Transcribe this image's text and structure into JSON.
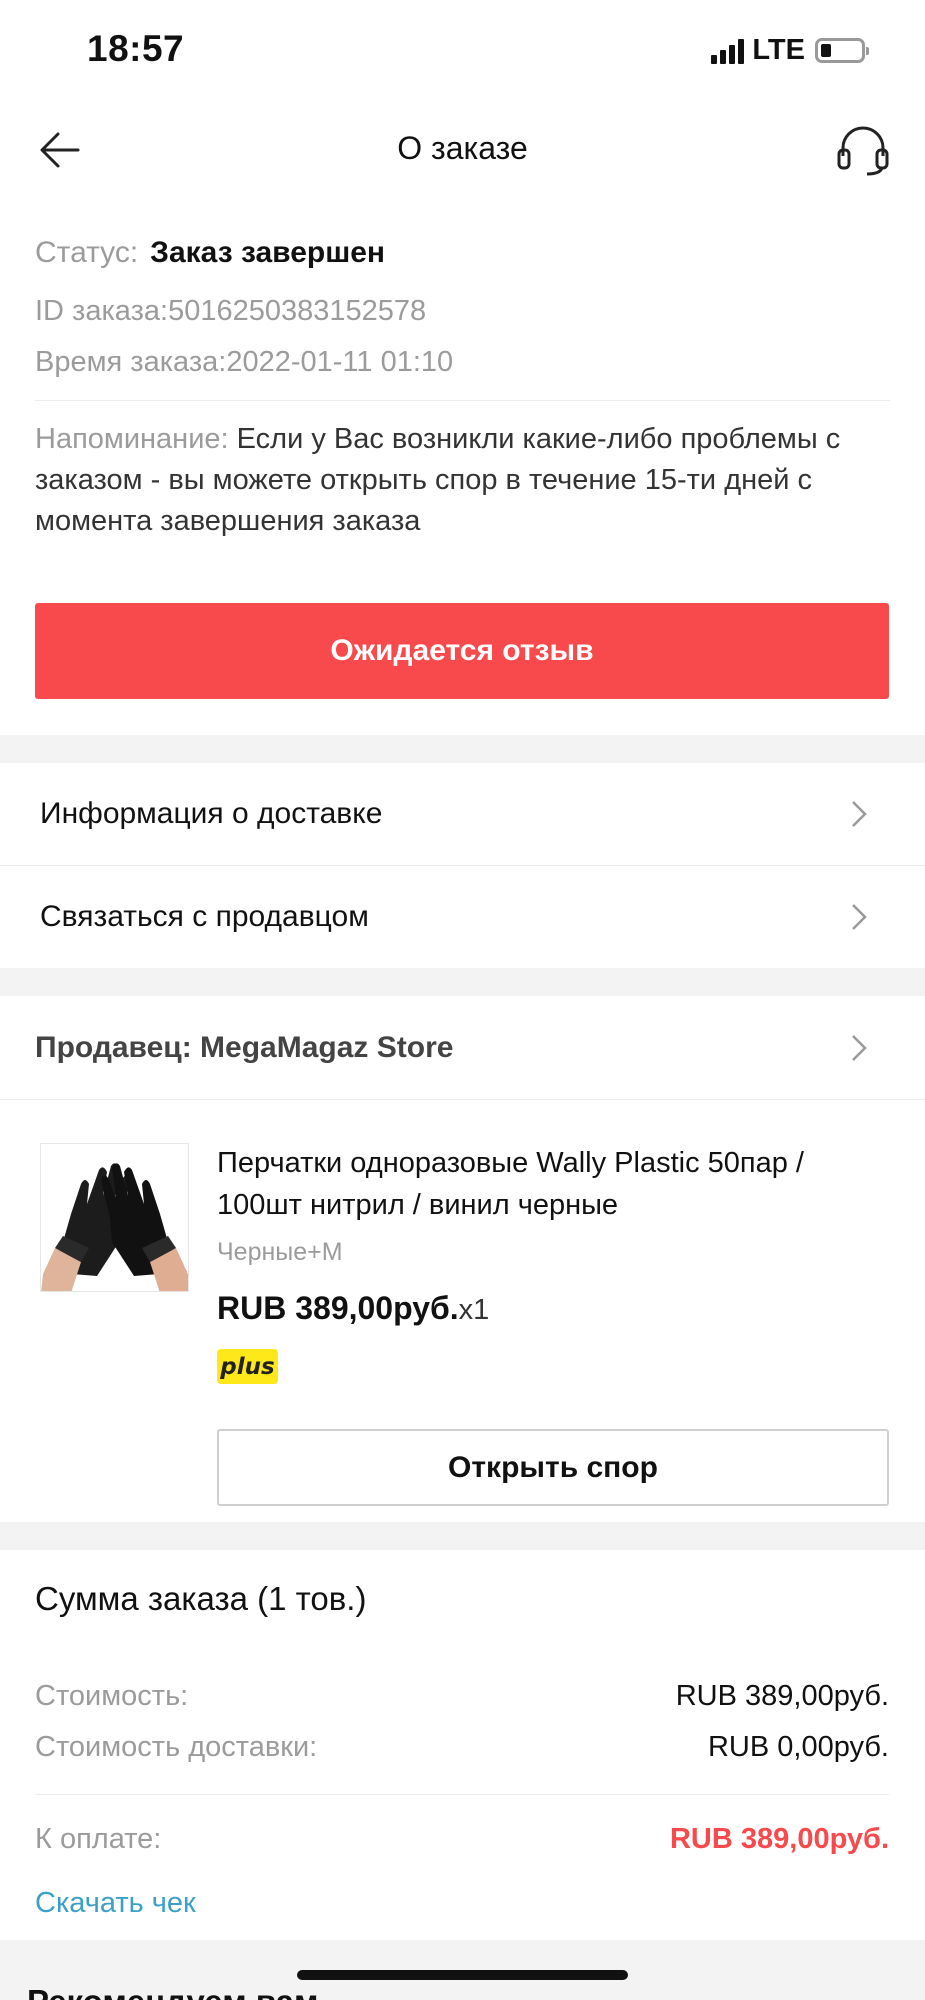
{
  "status_bar": {
    "time": "18:57",
    "network": "LTE"
  },
  "nav": {
    "title": "О заказе",
    "back_icon": "arrow-left-icon",
    "support_icon": "headset-icon"
  },
  "order": {
    "status_label": "Статус:",
    "status_value": "Заказ завершен",
    "id_line": "ID заказа:5016250383152578",
    "time_line": "Время заказа:2022-01-11 01:10",
    "reminder_label": "Напоминание:",
    "reminder_text": "Если у Вас возникли какие-либо проблемы с заказом - вы можете открыть спор в течение 15-ти дней с момента завершения заказа",
    "primary_button": "Ожидается отзыв"
  },
  "links": {
    "delivery_info": "Информация о доставке",
    "contact_seller": "Связаться с продавцом"
  },
  "seller": {
    "label": "Продавец: MegaMagaz Store"
  },
  "product": {
    "title": "Перчатки одноразовые Wally Plastic 50пар / 100шт нитрил / винил черные",
    "variant": "Черные+M",
    "price": "RUB 389,00руб.",
    "quantity": "x1",
    "badge": "plus",
    "dispute_button": "Открыть спор"
  },
  "summary": {
    "title": "Сумма заказа (1 тов.)",
    "cost_label": "Стоимость:",
    "cost_value": "RUB 389,00руб.",
    "shipping_label": "Стоимость доставки:",
    "shipping_value": "RUB 0,00руб.",
    "total_label": "К оплате:",
    "total_value": "RUB 389,00руб.",
    "receipt_link": "Скачать чек"
  },
  "recommend": {
    "title": "Рекомендуем вам"
  },
  "colors": {
    "accent": "#f84a4d",
    "link": "#3aa0c9",
    "badge": "#ffe81a"
  }
}
